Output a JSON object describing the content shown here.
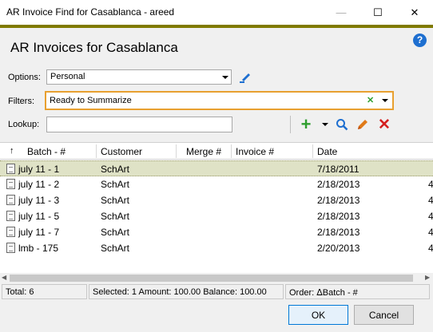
{
  "window": {
    "title": "AR Invoice Find for Casablanca - areed",
    "min_glyph": "—",
    "max_glyph": "☐",
    "close_glyph": "✕"
  },
  "header": {
    "title": "AR Invoices for Casablanca",
    "help_glyph": "?"
  },
  "options": {
    "label": "Options:",
    "value": "Personal"
  },
  "filters": {
    "label": "Filters:",
    "value": "Ready to Summarize",
    "clear_glyph": "✕"
  },
  "lookup": {
    "label": "Lookup:",
    "value": ""
  },
  "toolbar": {
    "add_glyph": "+",
    "delete_glyph": "✕"
  },
  "grid": {
    "columns": [
      "Batch - #",
      "Customer",
      "Merge #",
      "Invoice #",
      "Date"
    ],
    "sort_glyph": "↑",
    "rows": [
      {
        "batch": "july 11 - 1",
        "customer": "SchArt",
        "merge": "",
        "invoice": "",
        "date": "7/18/2011",
        "extra": "",
        "selected": true
      },
      {
        "batch": "july 11 - 2",
        "customer": "SchArt",
        "merge": "",
        "invoice": "",
        "date": "2/18/2013",
        "extra": "4",
        "selected": false
      },
      {
        "batch": "july 11 - 3",
        "customer": "SchArt",
        "merge": "",
        "invoice": "",
        "date": "2/18/2013",
        "extra": "4",
        "selected": false
      },
      {
        "batch": "july 11 - 5",
        "customer": "SchArt",
        "merge": "",
        "invoice": "",
        "date": "2/18/2013",
        "extra": "4",
        "selected": false
      },
      {
        "batch": "july 11 - 7",
        "customer": "SchArt",
        "merge": "",
        "invoice": "",
        "date": "2/18/2013",
        "extra": "4",
        "selected": false
      },
      {
        "batch": "lmb - 175",
        "customer": "SchArt",
        "merge": "",
        "invoice": "",
        "date": "2/20/2013",
        "extra": "4",
        "selected": false
      }
    ]
  },
  "status": {
    "total": "Total: 6",
    "selection": "Selected: 1  Amount: 100.00  Balance: 100.00",
    "order": "Order: ᐃBatch - #"
  },
  "buttons": {
    "ok": "OK",
    "cancel": "Cancel"
  },
  "colors": {
    "accent_bar": "#807a00",
    "filter_border": "#e8a030",
    "add": "#2e9e2e",
    "delete": "#d42020",
    "search": "#1e6fd0"
  }
}
